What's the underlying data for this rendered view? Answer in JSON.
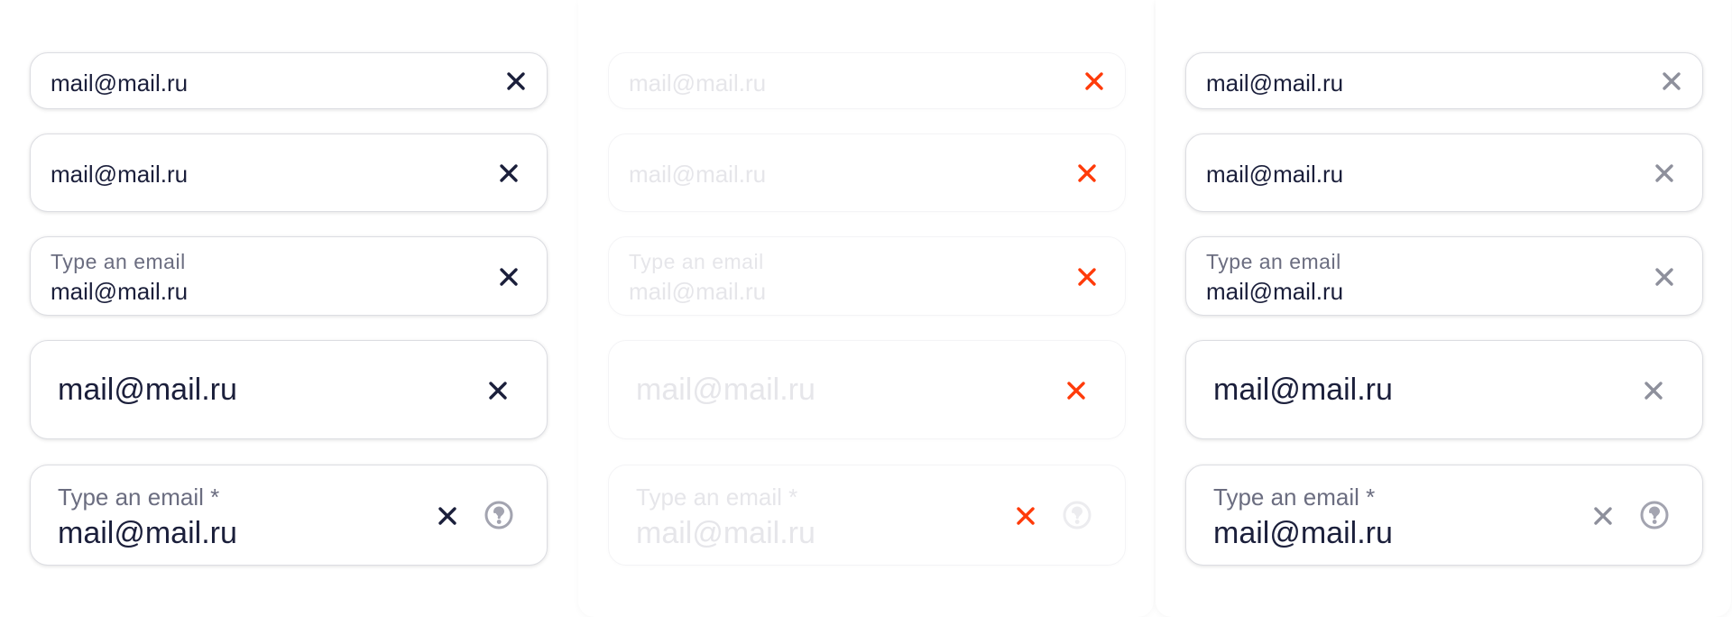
{
  "columns": [
    {
      "state": "default",
      "fields": [
        {
          "value": "mail@mail.ru"
        },
        {
          "value": "mail@mail.ru"
        },
        {
          "label": "Type an email",
          "value": "mail@mail.ru"
        },
        {
          "value": "mail@mail.ru"
        },
        {
          "label": "Type an email *",
          "value": "mail@mail.ru"
        }
      ]
    },
    {
      "state": "disabled",
      "fields": [
        {
          "value": "mail@mail.ru"
        },
        {
          "value": "mail@mail.ru"
        },
        {
          "label": "Type an email",
          "value": "mail@mail.ru"
        },
        {
          "value": "mail@mail.ru"
        },
        {
          "label": "Type an email *",
          "value": "mail@mail.ru"
        }
      ]
    },
    {
      "state": "readonly",
      "fields": [
        {
          "value": "mail@mail.ru"
        },
        {
          "value": "mail@mail.ru"
        },
        {
          "label": "Type an email",
          "value": "mail@mail.ru"
        },
        {
          "value": "mail@mail.ru"
        },
        {
          "label": "Type an email *",
          "value": "mail@mail.ru"
        }
      ]
    }
  ],
  "icons": {
    "clear": "close-icon",
    "help": "question-circle-icon"
  },
  "colors": {
    "text": "#1b1f3b",
    "label": "#6b6d80",
    "clear_default": "#1b1f3b",
    "clear_disabled": "#ff3b0a",
    "clear_readonly": "#8e909c",
    "disabled_text": "#e6e6ea"
  }
}
